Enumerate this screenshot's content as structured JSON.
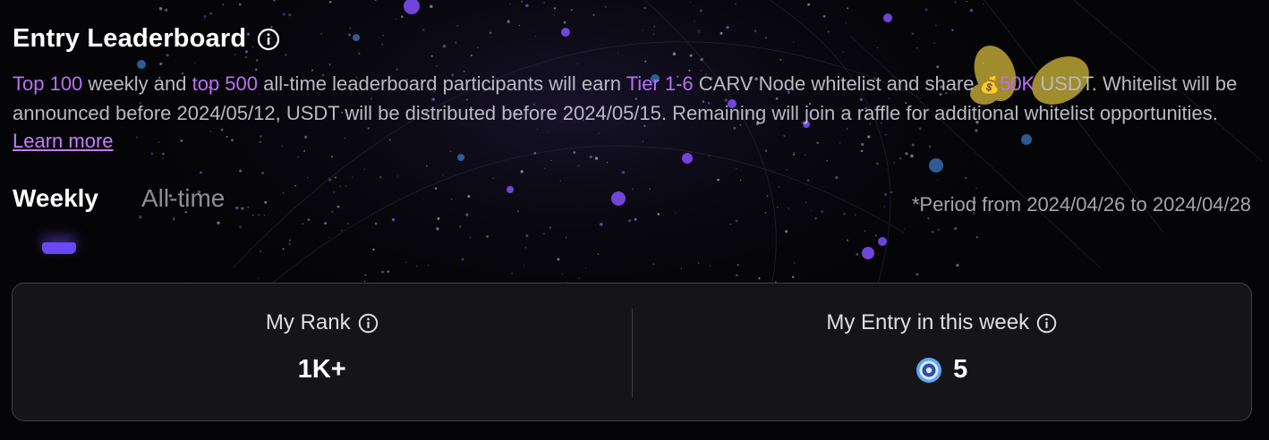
{
  "header": {
    "title": "Entry Leaderboard"
  },
  "description": {
    "p1": "Top 100",
    "p2": " weekly and ",
    "p3": "top 500",
    "p4": " all-time leaderboard participants will earn ",
    "p5": "Tier 1-6",
    "p6": " CARV Node whitelist and share ",
    "p7": "💰",
    "p8": "50K",
    "p9": " USDT. Whitelist will be announced before 2024/05/12, USDT will be distributed before 2024/05/15. Remaining will join a raffle for additional whitelist opportunities. ",
    "learn_more": "Learn more"
  },
  "tabs": [
    {
      "label": "Weekly",
      "active": true
    },
    {
      "label": "All-time",
      "active": false
    }
  ],
  "period": "*Period from 2024/04/26 to 2024/04/28",
  "stats": {
    "rank_label": "My Rank",
    "rank_value": "1K+",
    "entry_label": "My Entry in this week",
    "entry_value": "5"
  },
  "colors": {
    "accent_purple": "#b870f5",
    "tab_indicator": "#6b48f5",
    "card_bg": "#141419"
  },
  "icons": [
    "info-icon",
    "money-bag-icon",
    "entry-coin-icon"
  ]
}
